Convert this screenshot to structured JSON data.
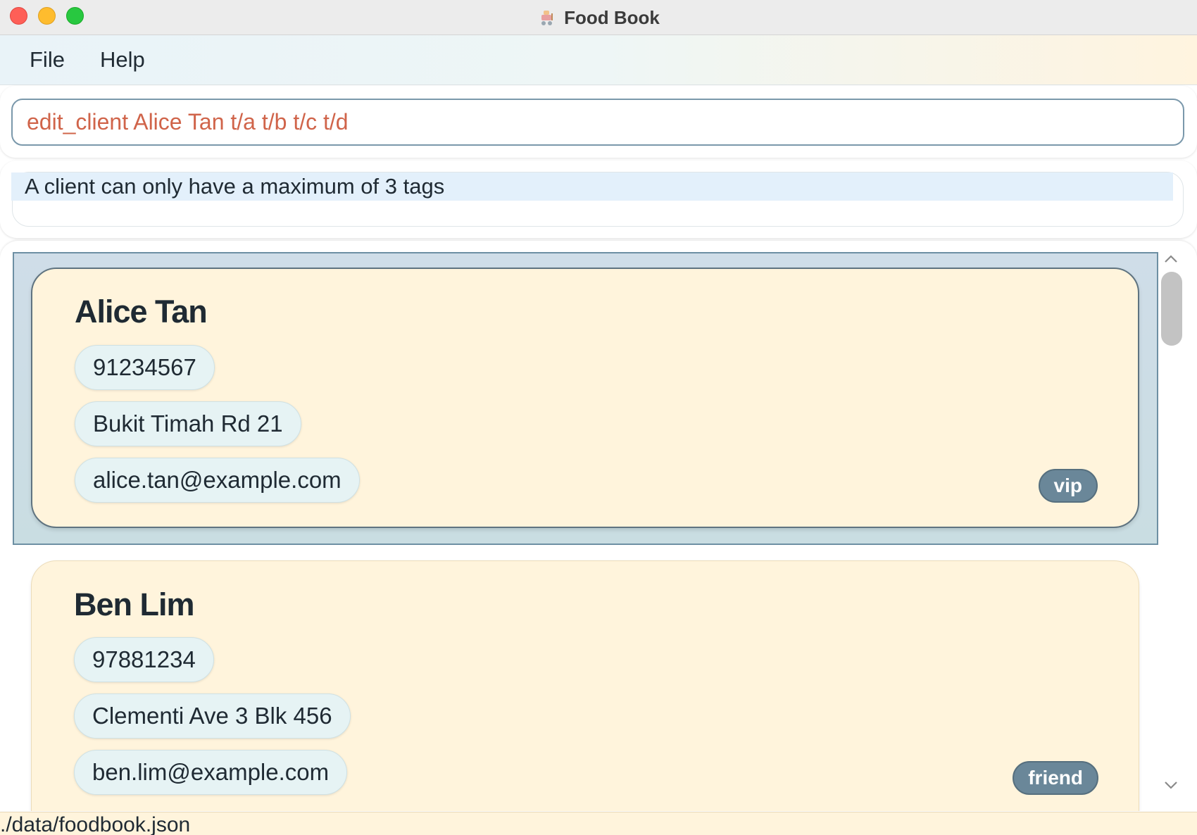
{
  "window": {
    "title": "Food Book"
  },
  "menu": {
    "file": "File",
    "help": "Help"
  },
  "command": {
    "value": "edit_client Alice Tan t/a t/b t/c t/d"
  },
  "result": {
    "message": "A client can only have a maximum of 3 tags"
  },
  "clients": [
    {
      "name": "Alice Tan",
      "phone": "91234567",
      "address": "Bukit Timah Rd 21",
      "email": "alice.tan@example.com",
      "tag": "vip"
    },
    {
      "name": "Ben Lim",
      "phone": "97881234",
      "address": "Clementi Ave 3 Blk 456",
      "email": "ben.lim@example.com",
      "tag": "friend"
    }
  ],
  "status": {
    "path": "./data/foodbook.json"
  },
  "colors": {
    "command_text": "#d0644a",
    "card_bg": "#fff4dc",
    "tag_bg": "#6a8799",
    "selection_bg": "#cfdde8"
  },
  "icons": {
    "app": "food-cart-icon",
    "scroll_up": "chevron-up-icon",
    "scroll_down": "chevron-down-icon"
  }
}
